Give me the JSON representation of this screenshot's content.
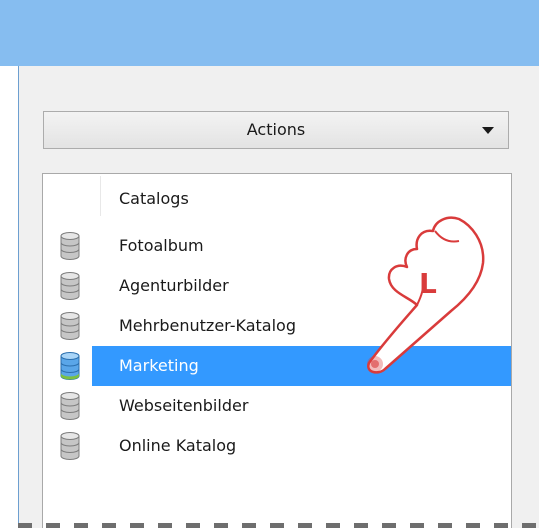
{
  "toolbar": {
    "actions_label": "Actions",
    "dropdown_icon": "chevron-down-icon"
  },
  "catalogs": {
    "header": "Catalogs",
    "items": [
      {
        "label": "Fotoalbum",
        "selected": false,
        "icon": "database-icon"
      },
      {
        "label": "Agenturbilder",
        "selected": false,
        "icon": "database-icon"
      },
      {
        "label": "Mehrbenutzer-Katalog",
        "selected": false,
        "icon": "database-icon"
      },
      {
        "label": "Marketing",
        "selected": true,
        "icon": "database-icon"
      },
      {
        "label": "Webseitenbilder",
        "selected": false,
        "icon": "database-icon"
      },
      {
        "label": "Online Katalog",
        "selected": false,
        "icon": "database-icon"
      }
    ]
  },
  "cursor": {
    "label": "L",
    "icon": "hand-pointer-icon"
  },
  "colors": {
    "titlebar": "#86bdf0",
    "selection": "#3399ff",
    "cursor_outline": "#d93b3b"
  }
}
